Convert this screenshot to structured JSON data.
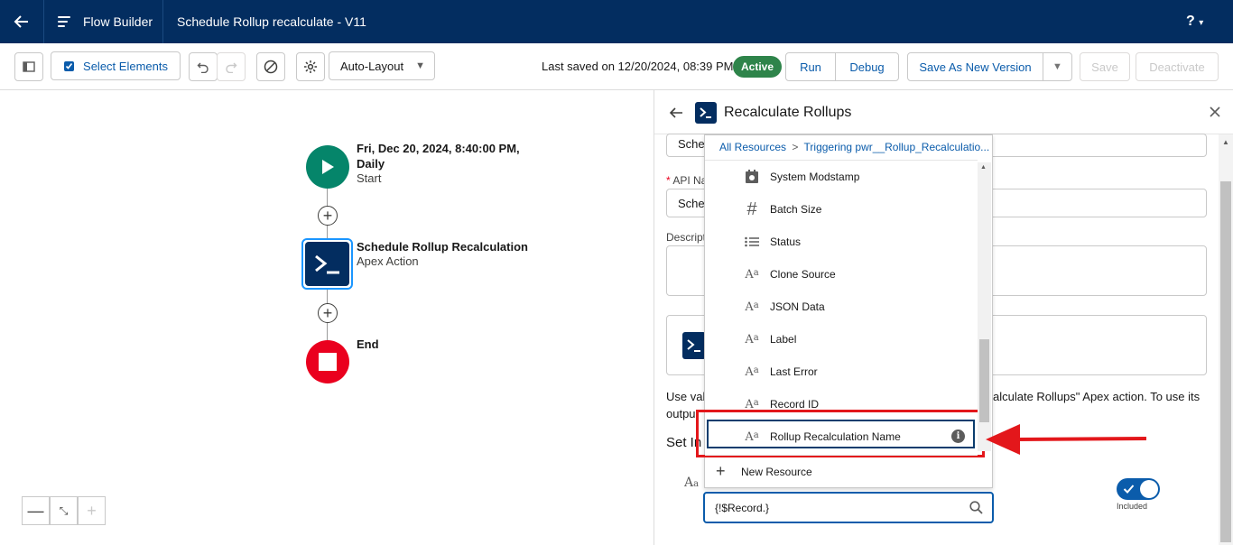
{
  "header": {
    "app_name": "Flow Builder",
    "flow_title": "Schedule Rollup recalculate - V11",
    "help_label": "?"
  },
  "toolbar": {
    "select_elements": "Select Elements",
    "layout_value": "Auto-Layout",
    "last_saved": "Last saved on 12/20/2024, 08:39 PM",
    "status_badge": "Active",
    "run": "Run",
    "debug": "Debug",
    "save_as_new_version": "Save As New Version",
    "save": "Save",
    "deactivate": "Deactivate"
  },
  "canvas": {
    "start": {
      "title_line1": "Fri, Dec 20, 2024, 8:40:00 PM,",
      "title_line2": "Daily",
      "sub": "Start"
    },
    "action": {
      "title": "Schedule Rollup Recalculation",
      "sub": "Apex Action"
    },
    "end": {
      "title": "End"
    }
  },
  "panel": {
    "title": "Recalculate Rollups",
    "label_field_value": "Sche",
    "api_name_label": "API Na",
    "api_name_value": "Sche",
    "description_label": "Descript",
    "info_text_left": "Use val",
    "info_text_right": "alculate Rollups\" Apex action. To use its",
    "info_text_left2": "outpu",
    "set_input_label": "Set In",
    "toggle_label": "Included",
    "input_value": "{!$Record.}"
  },
  "dropdown": {
    "breadcrumb_root": "All Resources",
    "breadcrumb_sep": ">",
    "breadcrumb_leaf": "Triggering pwr__Rollup_Recalculatio...",
    "items": [
      {
        "icon": "calendar-icon",
        "label": "System Modstamp"
      },
      {
        "icon": "number-icon",
        "label": "Batch Size"
      },
      {
        "icon": "picklist-icon",
        "label": "Status"
      },
      {
        "icon": "text-icon",
        "label": "Clone Source"
      },
      {
        "icon": "text-icon",
        "label": "JSON Data"
      },
      {
        "icon": "text-icon",
        "label": "Label"
      },
      {
        "icon": "text-icon",
        "label": "Last Error"
      },
      {
        "icon": "text-icon",
        "label": "Record ID"
      },
      {
        "icon": "text-icon",
        "label": "Rollup Recalculation Name"
      }
    ],
    "new_resource": "New Resource"
  },
  "colors": {
    "header_bg": "#032d60",
    "brand_blue": "#0b5cab",
    "active_green": "#2e844a",
    "start_teal": "#05856a",
    "end_red": "#ea001e",
    "highlight_red": "#e3171b"
  }
}
